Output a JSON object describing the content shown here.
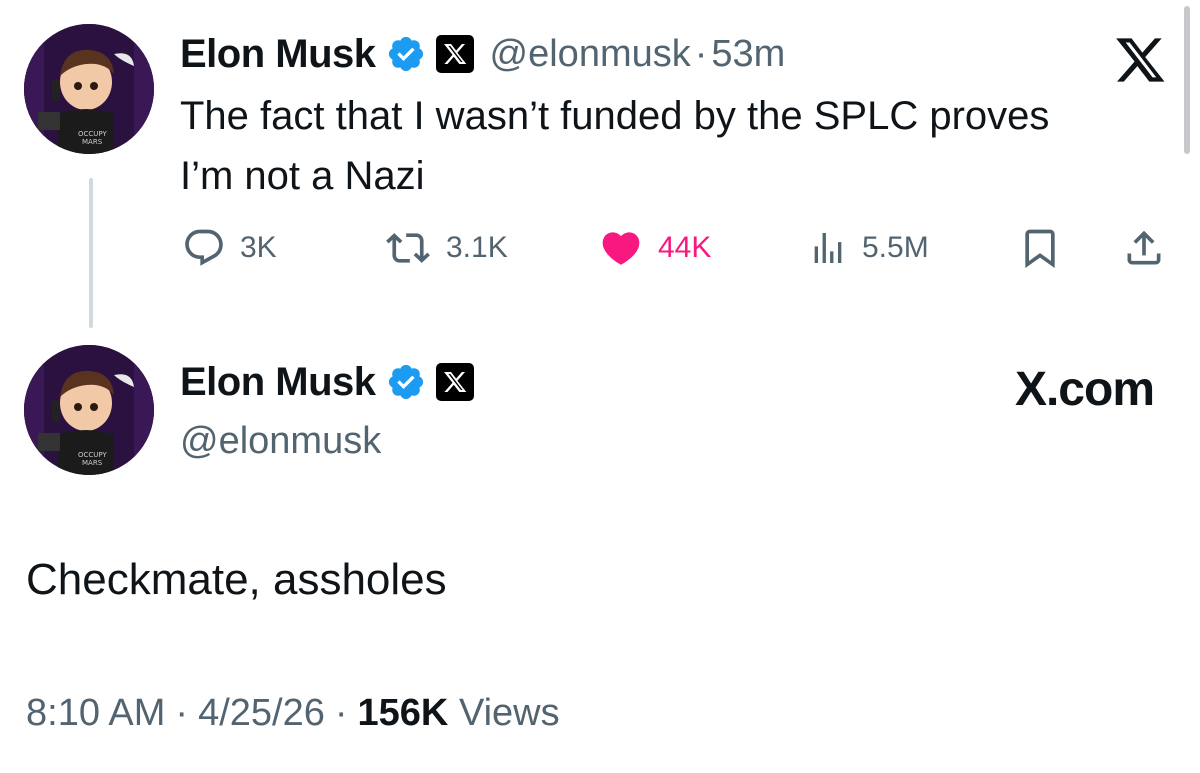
{
  "top_tweet": {
    "author_name": "Elon Musk",
    "handle": "@elonmusk",
    "separator": "·",
    "time": "53m",
    "text_line1": "The fact that I wasn’t funded by the SPLC proves",
    "text_line2": "I’m not a Nazi",
    "actions": {
      "replies": "3K",
      "reposts": "3.1K",
      "likes": "44K",
      "views": "5.5M"
    }
  },
  "bottom_card": {
    "author_name": "Elon Musk",
    "handle": "@elonmusk",
    "brand": "X.com",
    "text": "Checkmate, assholes",
    "timestamp": "8:10 AM",
    "date": "4/25/26",
    "views_count": "156K",
    "views_label": "Views",
    "separator": "·"
  },
  "colors": {
    "verified": "#1d9bf0",
    "like": "#f91880",
    "secondary_text": "#536471",
    "primary_text": "#0f1419"
  },
  "icons": {
    "reply": "reply-icon",
    "repost": "repost-icon",
    "like": "heart-icon",
    "views": "views-icon",
    "bookmark": "bookmark-icon",
    "share": "share-icon",
    "x_logo": "x-logo-icon",
    "verified": "verified-badge-icon"
  }
}
